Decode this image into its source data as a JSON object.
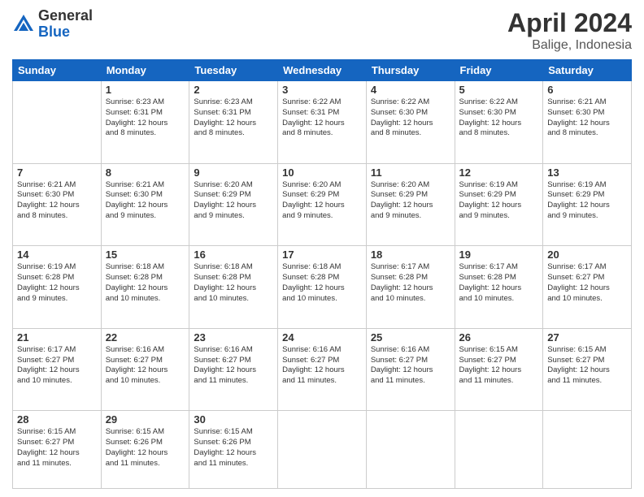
{
  "header": {
    "logo_general": "General",
    "logo_blue": "Blue",
    "title": "April 2024",
    "subtitle": "Balige, Indonesia"
  },
  "calendar": {
    "days_of_week": [
      "Sunday",
      "Monday",
      "Tuesday",
      "Wednesday",
      "Thursday",
      "Friday",
      "Saturday"
    ],
    "weeks": [
      [
        {
          "day": "",
          "info": ""
        },
        {
          "day": "1",
          "info": "Sunrise: 6:23 AM\nSunset: 6:31 PM\nDaylight: 12 hours\nand 8 minutes."
        },
        {
          "day": "2",
          "info": "Sunrise: 6:23 AM\nSunset: 6:31 PM\nDaylight: 12 hours\nand 8 minutes."
        },
        {
          "day": "3",
          "info": "Sunrise: 6:22 AM\nSunset: 6:31 PM\nDaylight: 12 hours\nand 8 minutes."
        },
        {
          "day": "4",
          "info": "Sunrise: 6:22 AM\nSunset: 6:30 PM\nDaylight: 12 hours\nand 8 minutes."
        },
        {
          "day": "5",
          "info": "Sunrise: 6:22 AM\nSunset: 6:30 PM\nDaylight: 12 hours\nand 8 minutes."
        },
        {
          "day": "6",
          "info": "Sunrise: 6:21 AM\nSunset: 6:30 PM\nDaylight: 12 hours\nand 8 minutes."
        }
      ],
      [
        {
          "day": "7",
          "info": "Sunrise: 6:21 AM\nSunset: 6:30 PM\nDaylight: 12 hours\nand 8 minutes."
        },
        {
          "day": "8",
          "info": "Sunrise: 6:21 AM\nSunset: 6:30 PM\nDaylight: 12 hours\nand 9 minutes."
        },
        {
          "day": "9",
          "info": "Sunrise: 6:20 AM\nSunset: 6:29 PM\nDaylight: 12 hours\nand 9 minutes."
        },
        {
          "day": "10",
          "info": "Sunrise: 6:20 AM\nSunset: 6:29 PM\nDaylight: 12 hours\nand 9 minutes."
        },
        {
          "day": "11",
          "info": "Sunrise: 6:20 AM\nSunset: 6:29 PM\nDaylight: 12 hours\nand 9 minutes."
        },
        {
          "day": "12",
          "info": "Sunrise: 6:19 AM\nSunset: 6:29 PM\nDaylight: 12 hours\nand 9 minutes."
        },
        {
          "day": "13",
          "info": "Sunrise: 6:19 AM\nSunset: 6:29 PM\nDaylight: 12 hours\nand 9 minutes."
        }
      ],
      [
        {
          "day": "14",
          "info": "Sunrise: 6:19 AM\nSunset: 6:28 PM\nDaylight: 12 hours\nand 9 minutes."
        },
        {
          "day": "15",
          "info": "Sunrise: 6:18 AM\nSunset: 6:28 PM\nDaylight: 12 hours\nand 10 minutes."
        },
        {
          "day": "16",
          "info": "Sunrise: 6:18 AM\nSunset: 6:28 PM\nDaylight: 12 hours\nand 10 minutes."
        },
        {
          "day": "17",
          "info": "Sunrise: 6:18 AM\nSunset: 6:28 PM\nDaylight: 12 hours\nand 10 minutes."
        },
        {
          "day": "18",
          "info": "Sunrise: 6:17 AM\nSunset: 6:28 PM\nDaylight: 12 hours\nand 10 minutes."
        },
        {
          "day": "19",
          "info": "Sunrise: 6:17 AM\nSunset: 6:28 PM\nDaylight: 12 hours\nand 10 minutes."
        },
        {
          "day": "20",
          "info": "Sunrise: 6:17 AM\nSunset: 6:27 PM\nDaylight: 12 hours\nand 10 minutes."
        }
      ],
      [
        {
          "day": "21",
          "info": "Sunrise: 6:17 AM\nSunset: 6:27 PM\nDaylight: 12 hours\nand 10 minutes."
        },
        {
          "day": "22",
          "info": "Sunrise: 6:16 AM\nSunset: 6:27 PM\nDaylight: 12 hours\nand 10 minutes."
        },
        {
          "day": "23",
          "info": "Sunrise: 6:16 AM\nSunset: 6:27 PM\nDaylight: 12 hours\nand 11 minutes."
        },
        {
          "day": "24",
          "info": "Sunrise: 6:16 AM\nSunset: 6:27 PM\nDaylight: 12 hours\nand 11 minutes."
        },
        {
          "day": "25",
          "info": "Sunrise: 6:16 AM\nSunset: 6:27 PM\nDaylight: 12 hours\nand 11 minutes."
        },
        {
          "day": "26",
          "info": "Sunrise: 6:15 AM\nSunset: 6:27 PM\nDaylight: 12 hours\nand 11 minutes."
        },
        {
          "day": "27",
          "info": "Sunrise: 6:15 AM\nSunset: 6:27 PM\nDaylight: 12 hours\nand 11 minutes."
        }
      ],
      [
        {
          "day": "28",
          "info": "Sunrise: 6:15 AM\nSunset: 6:27 PM\nDaylight: 12 hours\nand 11 minutes."
        },
        {
          "day": "29",
          "info": "Sunrise: 6:15 AM\nSunset: 6:26 PM\nDaylight: 12 hours\nand 11 minutes."
        },
        {
          "day": "30",
          "info": "Sunrise: 6:15 AM\nSunset: 6:26 PM\nDaylight: 12 hours\nand 11 minutes."
        },
        {
          "day": "",
          "info": ""
        },
        {
          "day": "",
          "info": ""
        },
        {
          "day": "",
          "info": ""
        },
        {
          "day": "",
          "info": ""
        }
      ]
    ]
  }
}
